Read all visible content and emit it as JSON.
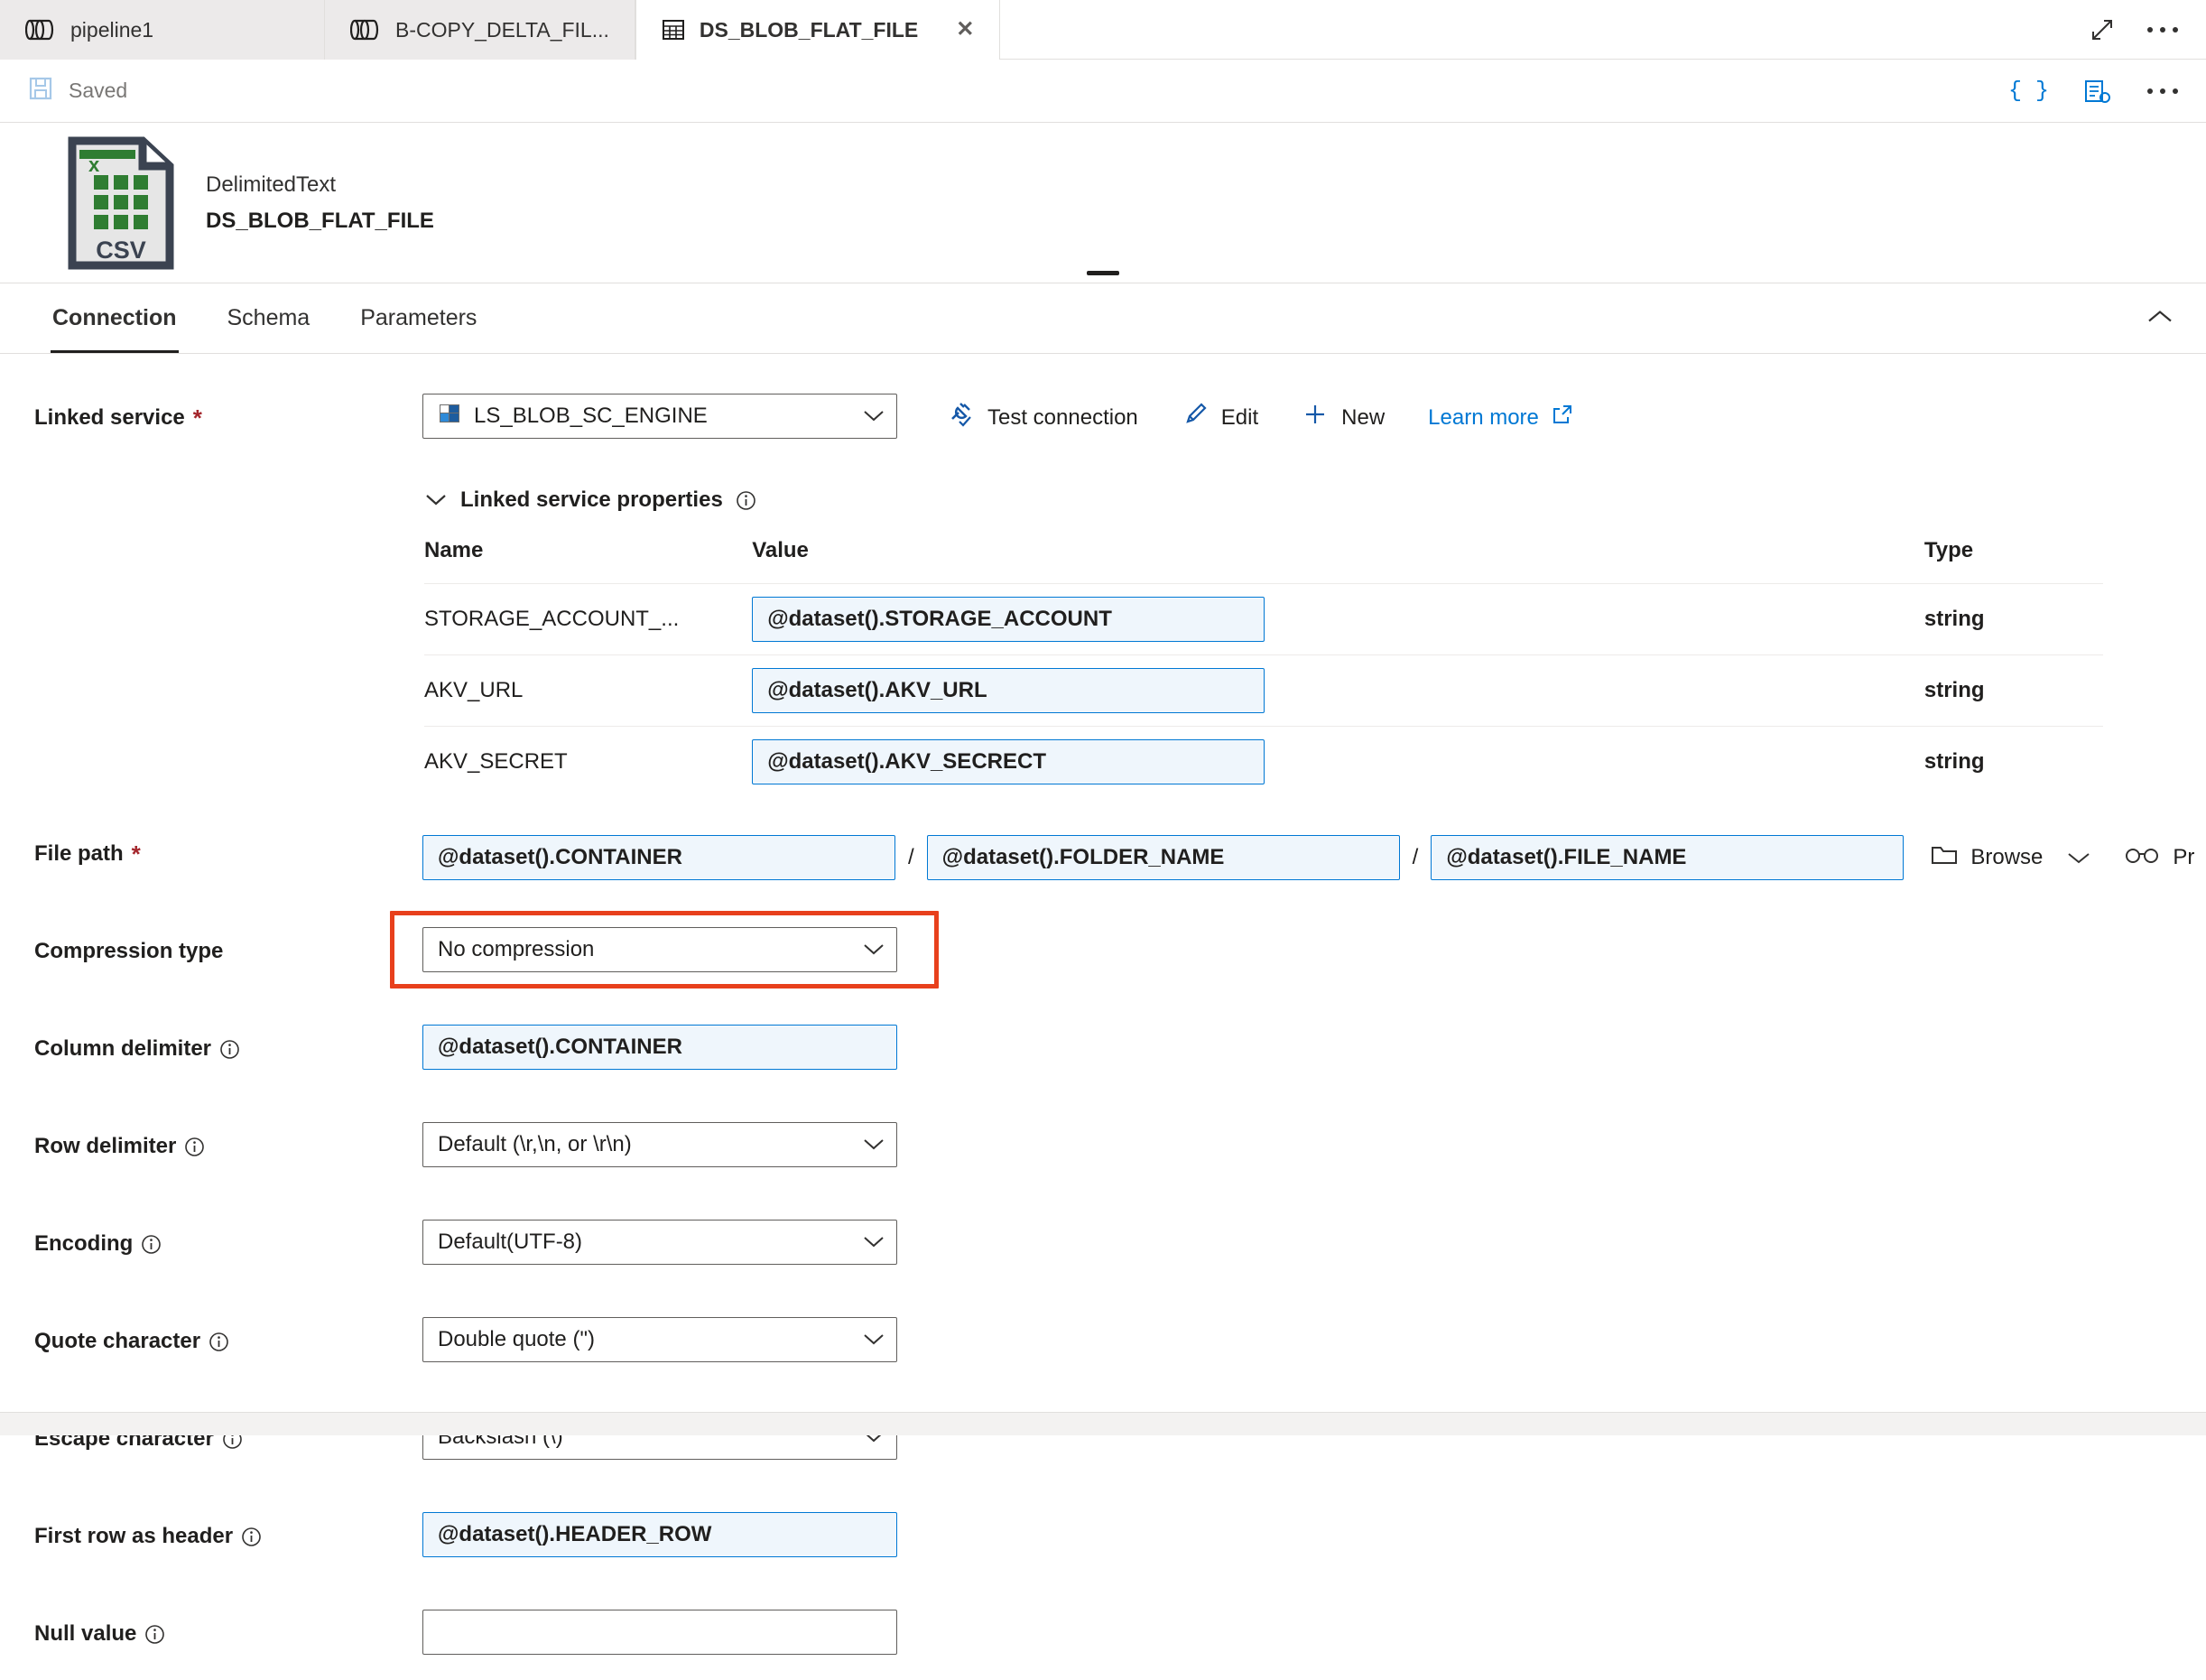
{
  "tabs": [
    {
      "label": "pipeline1",
      "icon": "pipeline-icon",
      "active": false,
      "closable": false
    },
    {
      "label": "B-COPY_DELTA_FIL...",
      "icon": "pipeline-icon",
      "active": false,
      "closable": false
    },
    {
      "label": "DS_BLOB_FLAT_FILE",
      "icon": "dataset-table-icon",
      "active": true,
      "closable": true
    }
  ],
  "tabstrip_right": {
    "expand_icon": "expand-diagonal-icon",
    "more_icon": "ellipsis-icon"
  },
  "commandbar": {
    "save_icon": "floppy-save-icon",
    "save_status": "Saved",
    "code_label": "{ }",
    "script_icon": "script-gear-icon",
    "more_icon": "ellipsis-icon"
  },
  "dataset_header": {
    "file_icon": "csv-file-icon",
    "type": "DelimitedText",
    "name": "DS_BLOB_FLAT_FILE",
    "drag_handle": "drag-handle"
  },
  "nav_tabs": [
    {
      "label": "Connection",
      "active": true
    },
    {
      "label": "Schema",
      "active": false
    },
    {
      "label": "Parameters",
      "active": false
    }
  ],
  "collapse_icon": "chevron-up-icon",
  "form": {
    "linked_service": {
      "label": "Linked service",
      "required": "*",
      "value": "LS_BLOB_SC_ENGINE",
      "icon": "blob-storage-icon",
      "chevron": "chevron-down-icon",
      "actions": [
        {
          "label": "Test connection",
          "icon": "plug-check-icon",
          "style": "dark"
        },
        {
          "label": "Edit",
          "icon": "pencil-icon",
          "style": "dark"
        },
        {
          "label": "New",
          "icon": "plus-icon",
          "style": "dark"
        },
        {
          "label": "Learn more",
          "icon": "external-link-icon",
          "style": "blue"
        }
      ]
    },
    "linked_service_properties": {
      "title": "Linked service properties",
      "chevron": "chevron-down-icon",
      "info_icon": "info-circle-icon",
      "columns": [
        "Name",
        "Value",
        "Type"
      ],
      "rows": [
        {
          "name": "STORAGE_ACCOUNT_...",
          "value": "@dataset().STORAGE_ACCOUNT",
          "type": "string"
        },
        {
          "name": "AKV_URL",
          "value": "@dataset().AKV_URL",
          "type": "string"
        },
        {
          "name": "AKV_SECRET",
          "value": "@dataset().AKV_SECRECT",
          "type": "string"
        }
      ]
    },
    "file_path": {
      "label": "File path",
      "required": "*",
      "container": "@dataset().CONTAINER",
      "folder": "@dataset().FOLDER_NAME",
      "file": "@dataset().FILE_NAME",
      "separator": "/",
      "browse_label": "Browse",
      "browse_icon": "folder-icon",
      "browse_chevron": "chevron-down-icon",
      "preview_label": "Pr",
      "preview_icon": "glasses-preview-icon"
    },
    "fields": [
      {
        "label": "Compression type",
        "has_info": false,
        "control": "combo",
        "value": "No compression",
        "annotated": true
      },
      {
        "label": "Column delimiter",
        "has_info": true,
        "control": "expression",
        "value": "@dataset().CONTAINER"
      },
      {
        "label": "Row delimiter",
        "has_info": true,
        "control": "combo",
        "value": "Default (\\r,\\n, or \\r\\n)"
      },
      {
        "label": "Encoding",
        "has_info": true,
        "control": "combo",
        "value": "Default(UTF-8)"
      },
      {
        "label": "Quote character",
        "has_info": true,
        "control": "combo",
        "value": "Double quote (\")"
      },
      {
        "label": "Escape character",
        "has_info": true,
        "control": "combo",
        "value": "Backslash (\\)"
      },
      {
        "label": "First row as header",
        "has_info": true,
        "control": "expression",
        "value": "@dataset().HEADER_ROW"
      },
      {
        "label": "Null value",
        "has_info": true,
        "control": "plain",
        "value": ""
      }
    ]
  },
  "colors": {
    "accent": "#0078d4",
    "annotation": "#e8401c",
    "required": "#a4262c",
    "expr_fill": "#eff6fc",
    "tab_inactive": "#eceaea",
    "border": "#e1dfdd"
  }
}
